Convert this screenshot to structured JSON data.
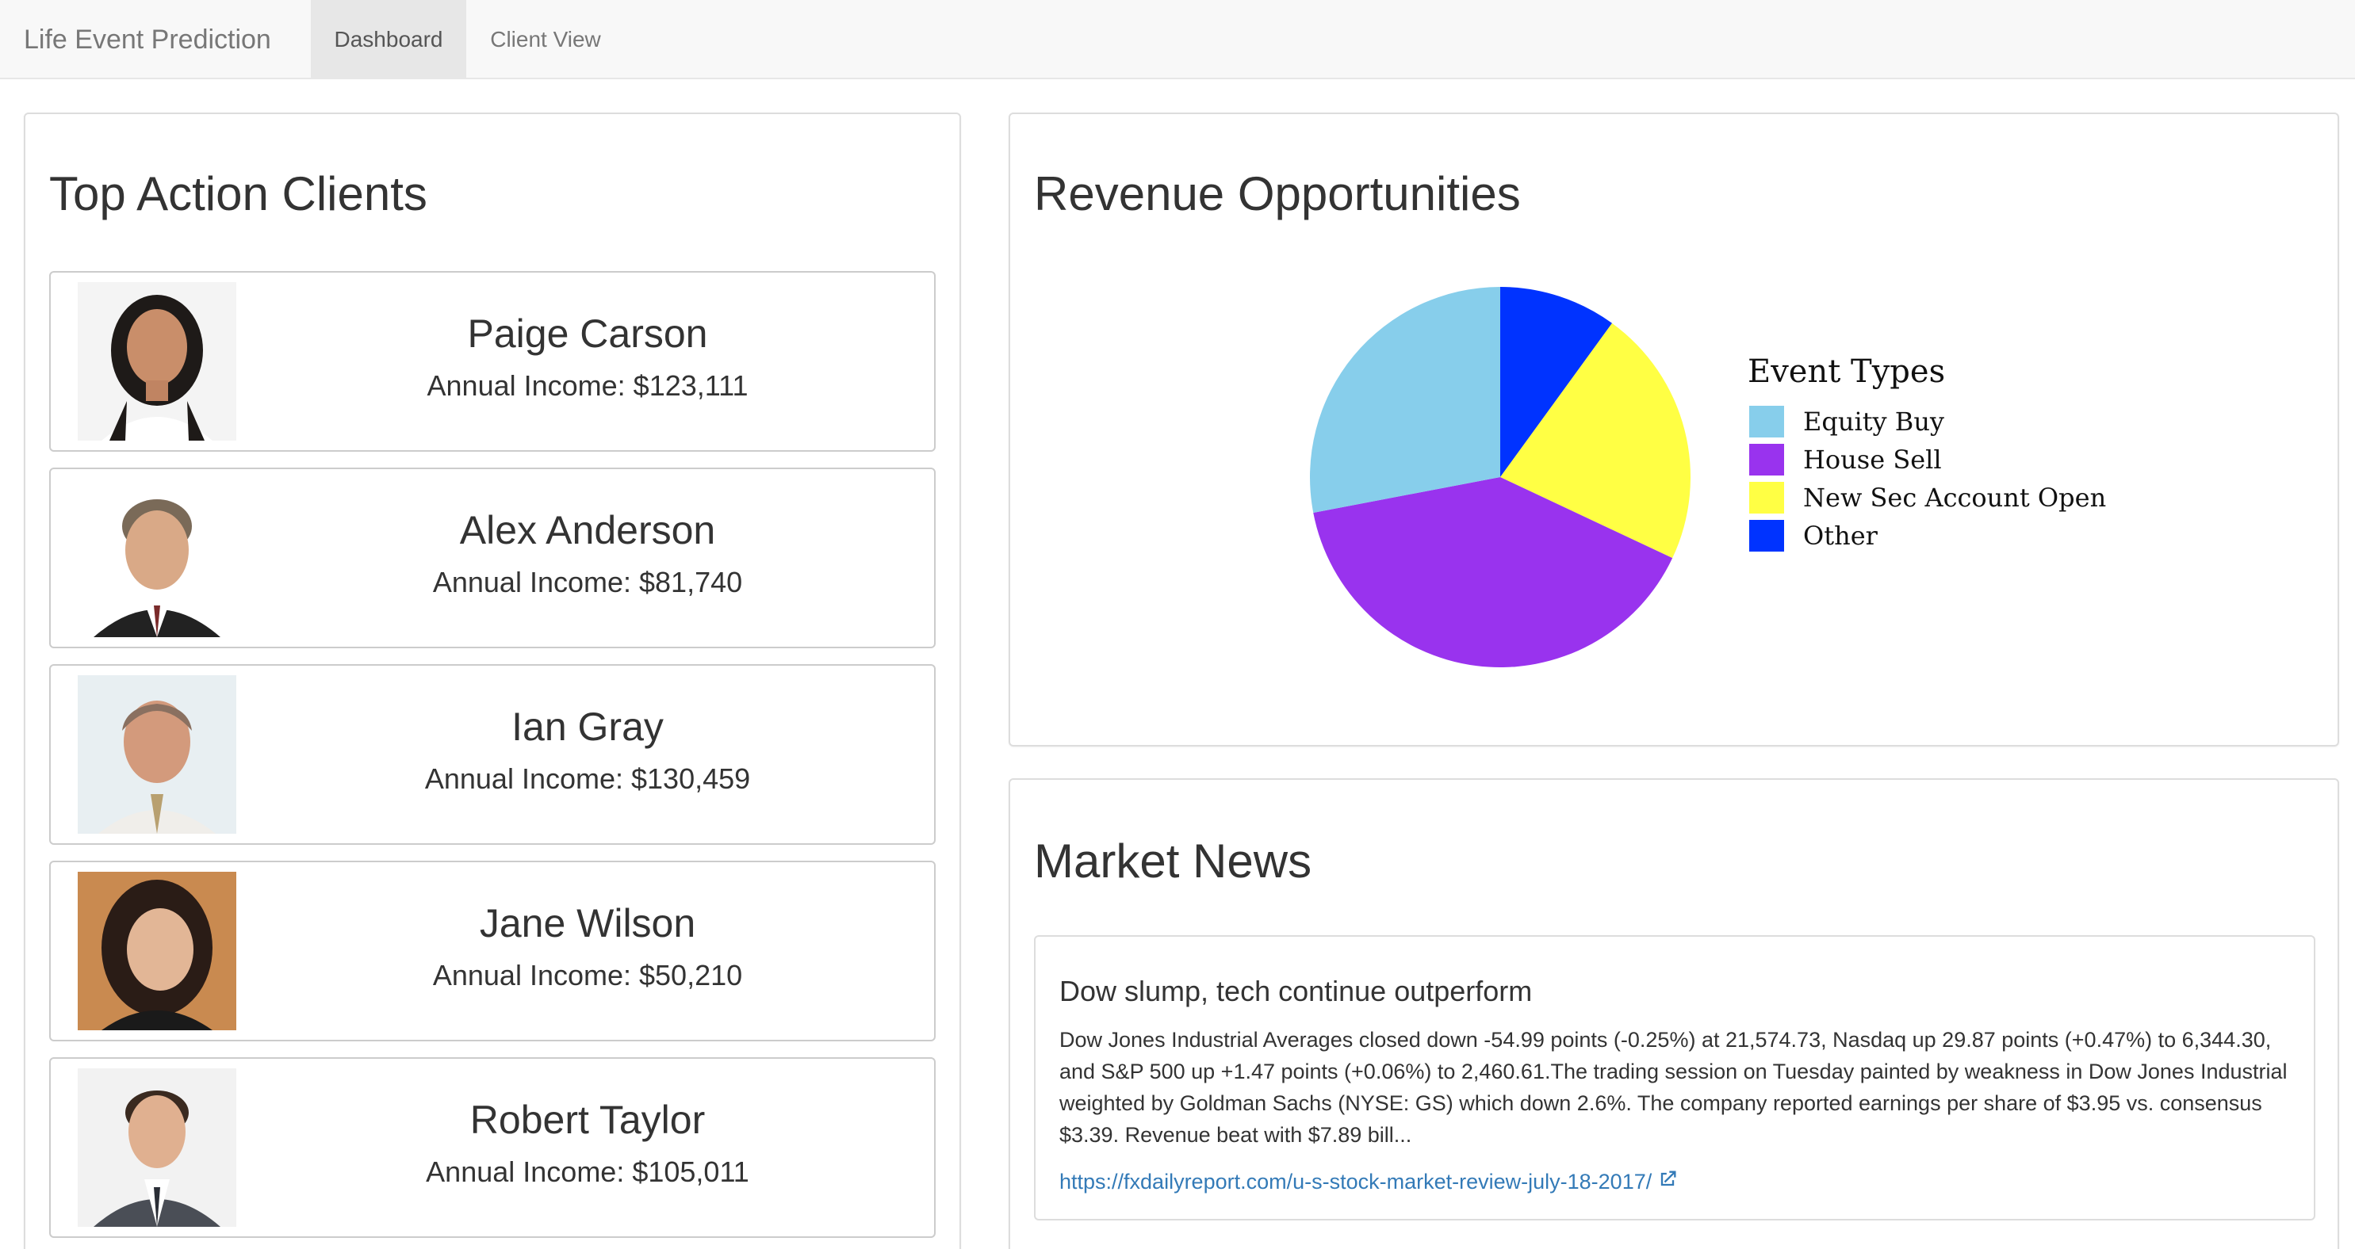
{
  "navbar": {
    "brand": "Life Event Prediction",
    "tabs": [
      {
        "label": "Dashboard",
        "active": true
      },
      {
        "label": "Client View",
        "active": false
      }
    ]
  },
  "clients_panel": {
    "title": "Top Action Clients",
    "clients": [
      {
        "name": "Paige Carson",
        "income": "Annual Income: $123,111"
      },
      {
        "name": "Alex Anderson",
        "income": "Annual Income: $81,740"
      },
      {
        "name": "Ian Gray",
        "income": "Annual Income: $130,459"
      },
      {
        "name": "Jane Wilson",
        "income": "Annual Income: $50,210"
      },
      {
        "name": "Robert Taylor",
        "income": "Annual Income: $105,011"
      }
    ]
  },
  "revenue_panel": {
    "title": "Revenue Opportunities"
  },
  "chart_data": {
    "type": "pie",
    "legend_title": "Event Types",
    "legend_position": "right",
    "slices": [
      {
        "label": "Equity Buy",
        "value": 28,
        "color": "#87ceeb"
      },
      {
        "label": "House Sell",
        "value": 40,
        "color": "#9933ee"
      },
      {
        "label": "New Sec Account Open",
        "value": 22,
        "color": "#ffff44"
      },
      {
        "label": "Other",
        "value": 10,
        "color": "#0033ff"
      }
    ]
  },
  "news_panel": {
    "title": "Market News",
    "headline": "Dow slump, tech continue outperform",
    "body": "Dow Jones Industrial Averages closed down -54.99 points (-0.25%) at 21,574.73, Nasdaq up 29.87 points (+0.47%) to 6,344.30, and S&P 500 up +1.47 points (+0.06%) to 2,460.61.The trading session on Tuesday painted by weakness in Dow Jones Industrial weighted by Goldman Sachs (NYSE: GS) which down 2.6%. The company reported earnings per share of $3.95 vs. consensus $3.39. Revenue beat with $7.89 bill...",
    "link": "https://fxdailyreport.com/u-s-stock-market-review-july-18-2017/"
  },
  "colors": {
    "navbar_bg": "#f8f8f8",
    "link": "#337ab7",
    "border": "#dddddd"
  }
}
